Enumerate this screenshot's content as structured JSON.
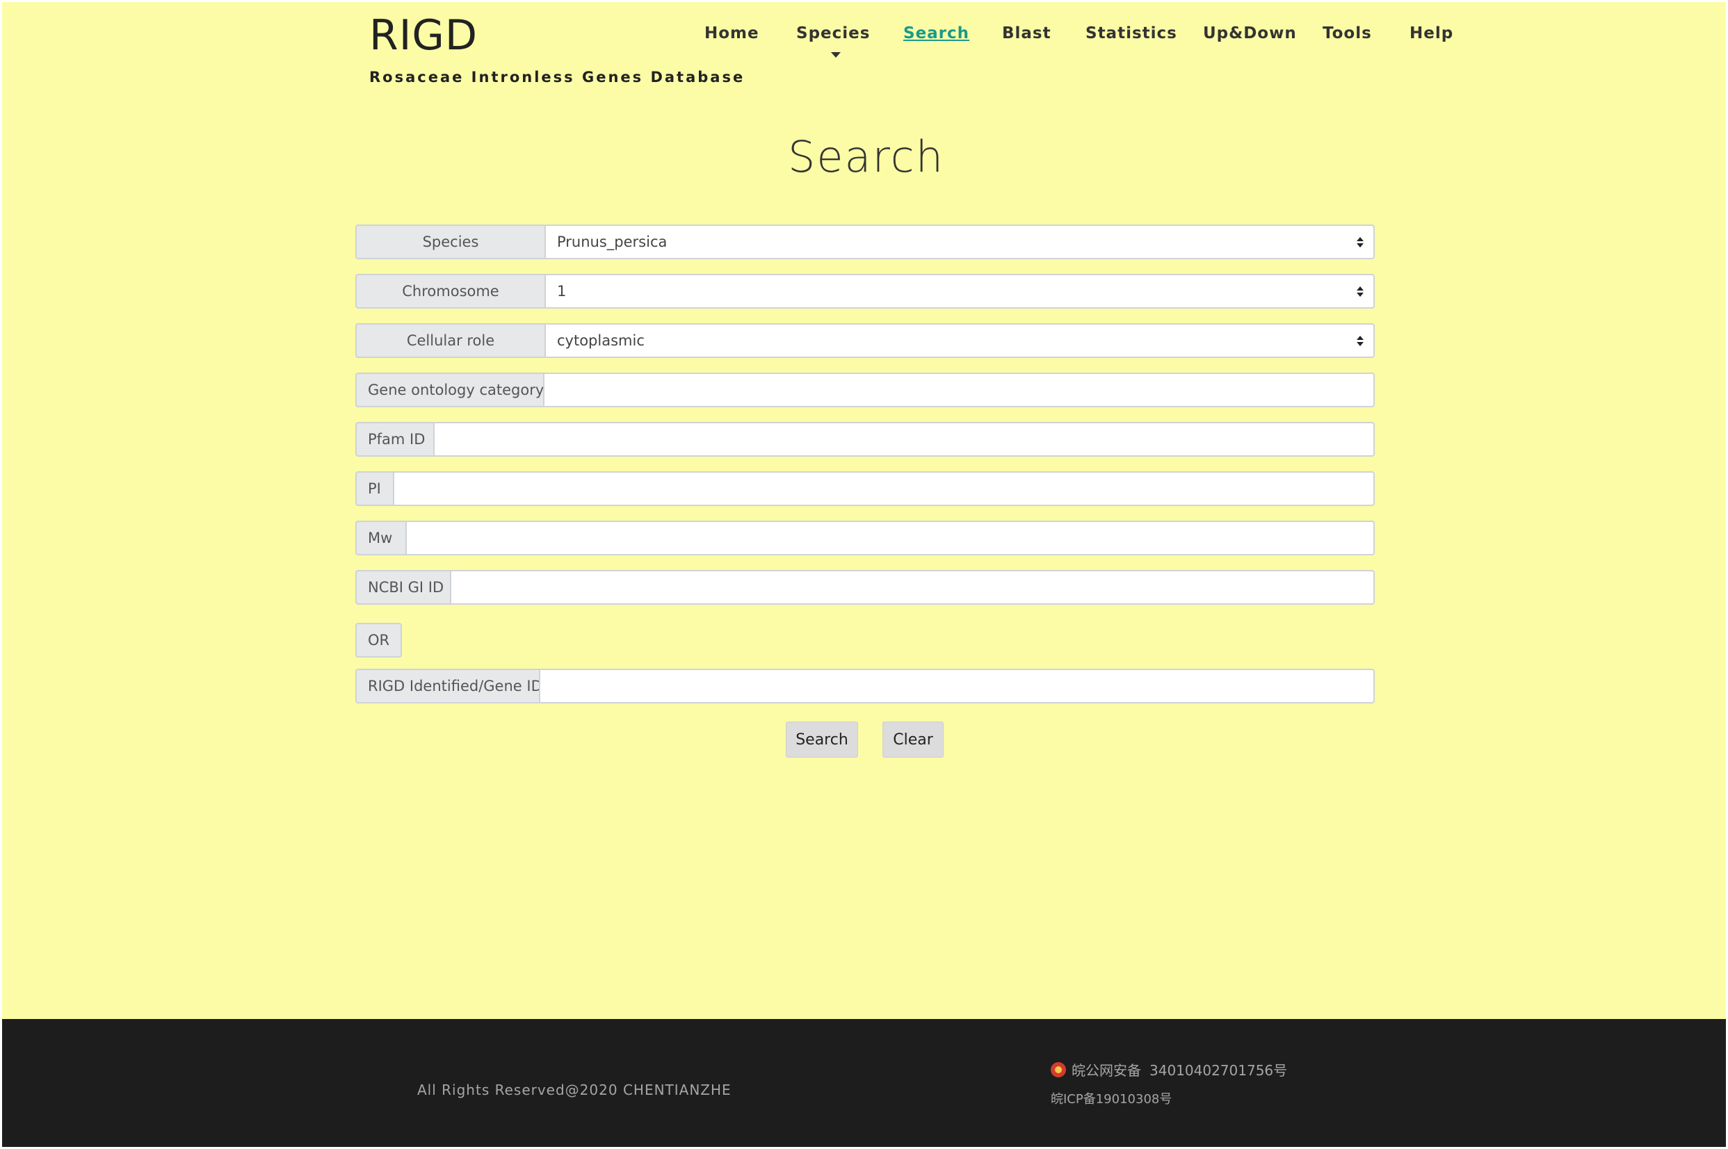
{
  "header": {
    "logo_title": "RIGD",
    "logo_subtitle": "Rosaceae Intronless Genes Database"
  },
  "nav": {
    "items": [
      {
        "label": "Home"
      },
      {
        "label": "Species"
      },
      {
        "label": "Search",
        "active": true
      },
      {
        "label": "Blast"
      },
      {
        "label": "Statistics"
      },
      {
        "label": "Up&Down"
      },
      {
        "label": "Tools"
      },
      {
        "label": "Help"
      }
    ]
  },
  "page_title": "Search",
  "form": {
    "species": {
      "label": "Species",
      "value": "Prunus_persica"
    },
    "chromosome": {
      "label": "Chromosome",
      "value": "1"
    },
    "cellular_role": {
      "label": "Cellular role",
      "value": "cytoplasmic"
    },
    "go_category": {
      "label": "Gene ontology category",
      "value": ""
    },
    "pfam_id": {
      "label": "Pfam ID",
      "value": ""
    },
    "pi": {
      "label": "PI",
      "value": ""
    },
    "mw": {
      "label": "Mw",
      "value": ""
    },
    "ncbi_gi_id": {
      "label": "NCBI GI ID",
      "value": ""
    },
    "or_label": "OR",
    "rigd_gene_id": {
      "label": "RIGD Identified/Gene ID",
      "value": ""
    },
    "search_button": "Search",
    "clear_button": "Clear"
  },
  "footer": {
    "copyright": "All Rights Reserved@2020 CHENTIANZHE",
    "beian_label": "皖公网安备",
    "beian_number": "34010402701756号",
    "icp": "皖ICP备19010308号"
  },
  "colors": {
    "page_background": "#fbfca5",
    "footer_background": "#1d1d1d",
    "active_nav": "#1a9a8c"
  }
}
